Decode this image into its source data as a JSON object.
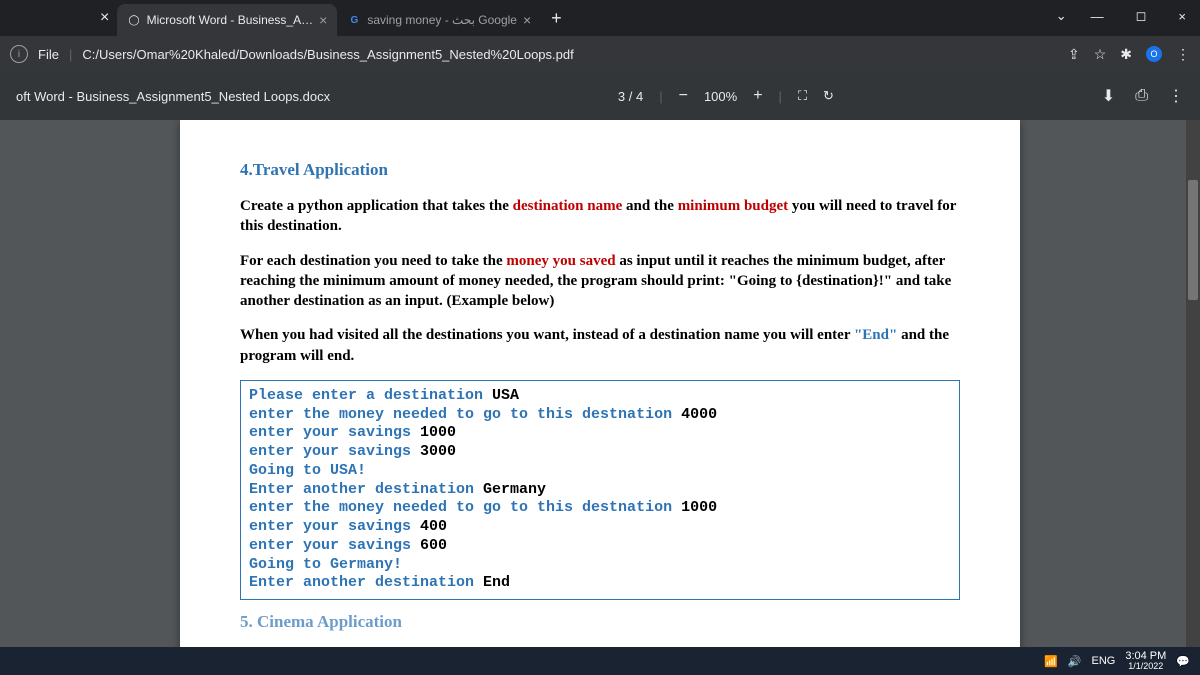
{
  "window": {
    "min": "—",
    "max": "◻",
    "close": "×",
    "chevron": "⌄"
  },
  "tabs": {
    "closeFirst": "×",
    "t1": {
      "icon": "◯",
      "label": "Microsoft Word - Business_Assig",
      "close": "×"
    },
    "t2": {
      "icon": "G",
      "label": "saving money - بحث Google",
      "close": "×"
    },
    "newTab": "+"
  },
  "addr": {
    "info": "i",
    "scheme": "File",
    "sep": "|",
    "path": "C:/Users/Omar%20Khaled/Downloads/Business_Assignment5_Nested%20Loops.pdf",
    "share": "⇪",
    "star": "☆",
    "ext": "✱",
    "badge": "O",
    "menu": "⋮"
  },
  "pdf": {
    "title": "oft Word - Business_Assignment5_Nested Loops.docx",
    "page": "3 / 4",
    "minus": "−",
    "zoom": "100%",
    "plus": "+",
    "fit": "⛶",
    "rotate": "↻",
    "download": "⬇",
    "print": "⎙",
    "more": "⋮"
  },
  "doc": {
    "h4": "4.Travel Application",
    "p1a": "Create a python application that takes the ",
    "p1b": "destination name ",
    "p1c": "and the ",
    "p1d": "minimum budget ",
    "p1e": "you will need to travel for this destination.",
    "p2a": "For each destination you need to take the ",
    "p2b": "money you saved ",
    "p2c": "as input until it reaches the minimum budget, after reaching the minimum amount of money needed, the program should print: \"Going to {destination}!\" and take another destination as an input. (Example below)",
    "p3a": "When you had visited all the destinations you want, instead of a destination name you will enter ",
    "p3b": "\"End\" ",
    "p3c": "and the program will end.",
    "c1": "Please enter a destination ",
    "v1": "USA",
    "c2": "enter the money needed to go to this destnation ",
    "v2": "4000",
    "c3": "enter your savings ",
    "v3": "1000",
    "c4": "enter your savings ",
    "v4": "3000",
    "c5": "Going to  USA!",
    "c6": "Enter another destination ",
    "v6": "Germany",
    "c7": "enter the money needed to go to this destnation ",
    "v7": "1000",
    "c8": "enter your savings ",
    "v8": "400",
    "c9": "enter your savings ",
    "v9": "600",
    "c10": "Going to  Germany!",
    "c11": "Enter another destination ",
    "v11": "End",
    "h5": "5. Cinema Application"
  },
  "taskbar": {
    "lang": "ENG",
    "time": "3:04 PM",
    "date": "1/1/2022",
    "sound": "🔊",
    "wifi": "📶",
    "chat": "💬"
  }
}
